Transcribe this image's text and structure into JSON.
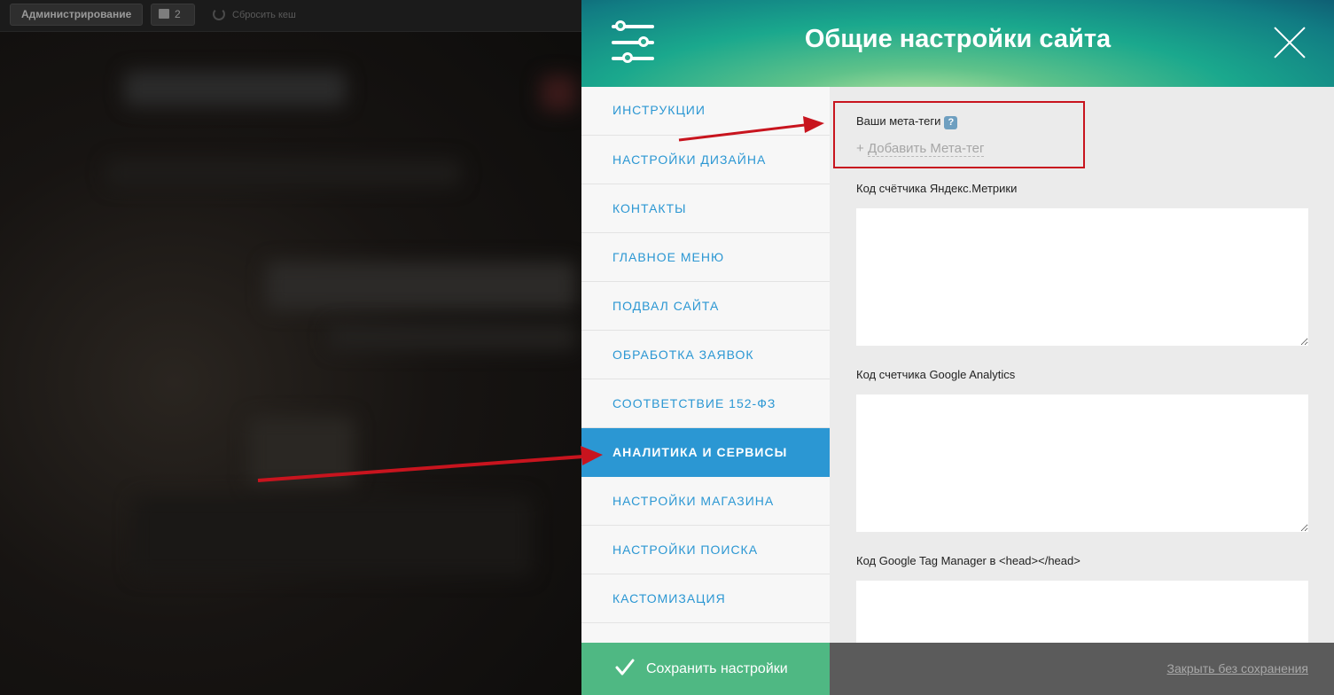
{
  "admin_bar": {
    "admin_label": "Администрирование",
    "notifications_count": "2",
    "reset_cache_label": "Сбросить кеш"
  },
  "header": {
    "title": "Общие настройки сайта",
    "icon": "sliders-icon",
    "close_icon": "close-icon"
  },
  "sidebar": {
    "items": [
      {
        "label": "ИНСТРУКЦИИ",
        "active": false
      },
      {
        "label": "НАСТРОЙКИ ДИЗАЙНА",
        "active": false
      },
      {
        "label": "КОНТАКТЫ",
        "active": false
      },
      {
        "label": "ГЛАВНОЕ МЕНЮ",
        "active": false
      },
      {
        "label": "ПОДВАЛ САЙТА",
        "active": false
      },
      {
        "label": "ОБРАБОТКА ЗАЯВОК",
        "active": false
      },
      {
        "label": "СООТВЕТСТВИЕ 152-ФЗ",
        "active": false
      },
      {
        "label": "АНАЛИТИКА И СЕРВИСЫ",
        "active": true
      },
      {
        "label": "НАСТРОЙКИ МАГАЗИНА",
        "active": false
      },
      {
        "label": "НАСТРОЙКИ ПОИСКА",
        "active": false
      },
      {
        "label": "КАСТОМИЗАЦИЯ",
        "active": false
      }
    ]
  },
  "content": {
    "meta_tags_label": "Ваши мета-теги",
    "help_mark": "?",
    "add_meta_plus": "+",
    "add_meta_label": "Добавить Мета-тег",
    "yandex_label": "Код счётчика Яндекс.Метрики",
    "yandex_value": "",
    "google_analytics_label": "Код счетчика Google Analytics",
    "google_analytics_value": "",
    "gtm_label": "Код Google Tag Manager в <head></head>",
    "gtm_value": ""
  },
  "footer": {
    "save_label": "Сохранить настройки",
    "close_without_save_label": "Закрыть без сохранения"
  },
  "colors": {
    "accent_blue": "#2b97d3",
    "save_green": "#4fb883",
    "annotation_red": "#c8141e"
  }
}
